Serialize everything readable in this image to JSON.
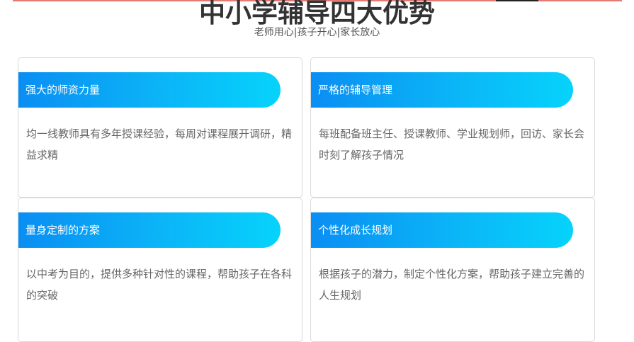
{
  "header": {
    "title": "中小学辅导四大优势",
    "subtitle": "老师用心|孩子开心|家长放心"
  },
  "cards": [
    {
      "title": "强大的师资力量",
      "description": "均一线教师具有多年授课经验，每周对课程展开调研，精益求精"
    },
    {
      "title": "严格的辅导管理",
      "description": "每班配备班主任、授课教师、学业规划师，回访、家长会时刻了解孩子情况"
    },
    {
      "title": "量身定制的方案",
      "description": "以中考为目的，提供多种针对性的课程，帮助孩子在各科的突破"
    },
    {
      "title": "个性化成长规划",
      "description": "根据孩子的潜力，制定个性化方案，帮助孩子建立完善的人生规划"
    }
  ]
}
